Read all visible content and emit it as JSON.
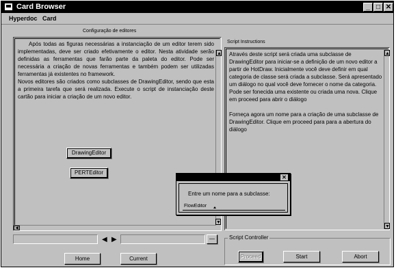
{
  "window": {
    "title": "Card Browser",
    "minimize": "_",
    "maximize": "□",
    "close": "✕"
  },
  "menu": {
    "hyperdoc": "Hyperdoc",
    "card": "Card"
  },
  "left_panel": {
    "title": "Configuração de editores",
    "paragraph1": "Após todas as figuras necessárias a instanciação de um editor terem sido implementadas, deve ser criado efetivamente o editor. Nesta atividade serão  definidas as ferramentas que farão parte da paleta do editor. Pode ser necessária a criação de novas ferramentas e também podem ser utilizadas ferramentas já existentes no framework.",
    "paragraph2": "Novos editores são criados como subclasses de DrawingEditor, sendo que esta a primeira tarefa que será realizada.  Execute o script de instanciação deste cartão para iniciar a criação de um novo editor.",
    "button_drawing": "DrawingEditor",
    "button_pert": "PERTEditor"
  },
  "right_panel": {
    "title": "Script Instructions",
    "paragraph1": "Através deste script será criada uma subclasse de DrawingEditor para iniciar-se a definição de um novo editor a partir de HotDraw. Inicialmente você deve definir em qual categoria de classe será criada a subclasse. Será apresentado um diálogo no qual você deve fornecer o nome da categoria. Pode ser fonecida uma existente ou criada uma nova. Clique em proceed para abrir o diálogo",
    "paragraph2": "Forneça agora um nome para a criação de uma subclasse de DrawingEditor. Clique em proceed para para a abertura do diálogo"
  },
  "nav": {
    "prev": "◀",
    "next": "▶",
    "home": "Home",
    "current": "Current",
    "dash": "—"
  },
  "script_controller": {
    "label": "Script Controller",
    "proceed": "Proceed",
    "start": "Start",
    "abort": "Abort"
  },
  "dialog": {
    "close": "✕",
    "prompt": "Entre um nome para a subclasse:",
    "value": "FlowEditor"
  }
}
